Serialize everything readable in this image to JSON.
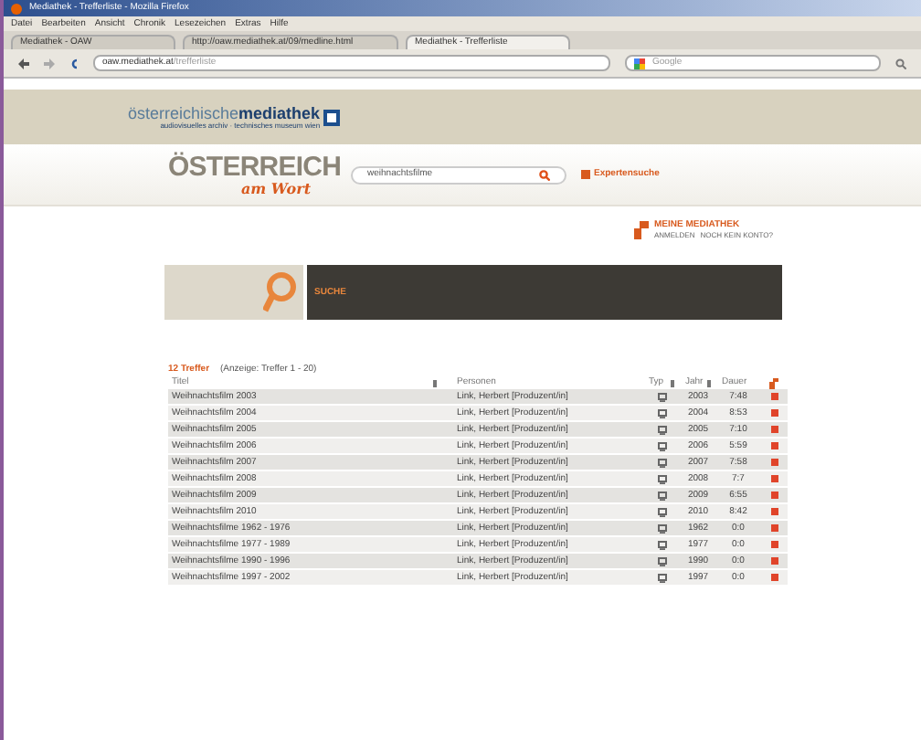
{
  "window": {
    "title": "Mediathek - Trefferliste - Mozilla Firefox"
  },
  "menu": [
    "Datei",
    "Bearbeiten",
    "Ansicht",
    "Chronik",
    "Lesezeichen",
    "Extras",
    "Hilfe"
  ],
  "tabs": [
    {
      "label": "Mediathek - OAW",
      "selected": false
    },
    {
      "label": "http://oaw.mediathek.at/09/medline.html",
      "selected": false
    },
    {
      "label": "Mediathek - Trefferliste",
      "selected": true
    }
  ],
  "address_bar": {
    "url_host": "oaw.mediathek.at",
    "url_path": "/trefferliste"
  },
  "search_bar": {
    "placeholder": "Google"
  },
  "site": {
    "logo_light": "österreichische",
    "logo_bold": "mediathek",
    "logo_tagline": "audiovisuelles archiv · technisches museum wien",
    "brand_main": "ÖSTERREICH",
    "brand_sub": "am Wort",
    "search_value": "weihnachtsfilme",
    "expert_search": "Expertensuche",
    "my_mediathek": "MEINE MEDIATHEK",
    "login": "ANMELDEN",
    "no_account": "NOCH KEIN KONTO?",
    "search_heading": "SUCHE"
  },
  "results": {
    "count": "12 Treffer",
    "range": "(Anzeige: Treffer 1 - 20)",
    "columns": [
      "Titel",
      "Personen",
      "Typ",
      "Jahr",
      "Dauer"
    ],
    "rows": [
      {
        "title": "Weihnachtsfilm 2003",
        "person": "Link, Herbert [Produzent/in]",
        "year": "2003",
        "duration": "7:48"
      },
      {
        "title": "Weihnachtsfilm 2004",
        "person": "Link, Herbert [Produzent/in]",
        "year": "2004",
        "duration": "8:53"
      },
      {
        "title": "Weihnachtsfilm 2005",
        "person": "Link, Herbert [Produzent/in]",
        "year": "2005",
        "duration": "7:10"
      },
      {
        "title": "Weihnachtsfilm 2006",
        "person": "Link, Herbert [Produzent/in]",
        "year": "2006",
        "duration": "5:59"
      },
      {
        "title": "Weihnachtsfilm 2007",
        "person": "Link, Herbert [Produzent/in]",
        "year": "2007",
        "duration": "7:58"
      },
      {
        "title": "Weihnachtsfilm 2008",
        "person": "Link, Herbert [Produzent/in]",
        "year": "2008",
        "duration": "7:7"
      },
      {
        "title": "Weihnachtsfilm 2009",
        "person": "Link, Herbert [Produzent/in]",
        "year": "2009",
        "duration": "6:55"
      },
      {
        "title": "Weihnachtsfilm 2010",
        "person": "Link, Herbert [Produzent/in]",
        "year": "2010",
        "duration": "8:42"
      },
      {
        "title": "Weihnachtsfilme 1962 - 1976",
        "person": "Link, Herbert [Produzent/in]",
        "year": "1962",
        "duration": "0:0"
      },
      {
        "title": "Weihnachtsfilme 1977 - 1989",
        "person": "Link, Herbert [Produzent/in]",
        "year": "1977",
        "duration": "0:0"
      },
      {
        "title": "Weihnachtsfilme 1990 - 1996",
        "person": "Link, Herbert [Produzent/in]",
        "year": "1990",
        "duration": "0:0"
      },
      {
        "title": "Weihnachtsfilme 1997 - 2002",
        "person": "Link, Herbert [Produzent/in]",
        "year": "1997",
        "duration": "0:0"
      }
    ]
  }
}
